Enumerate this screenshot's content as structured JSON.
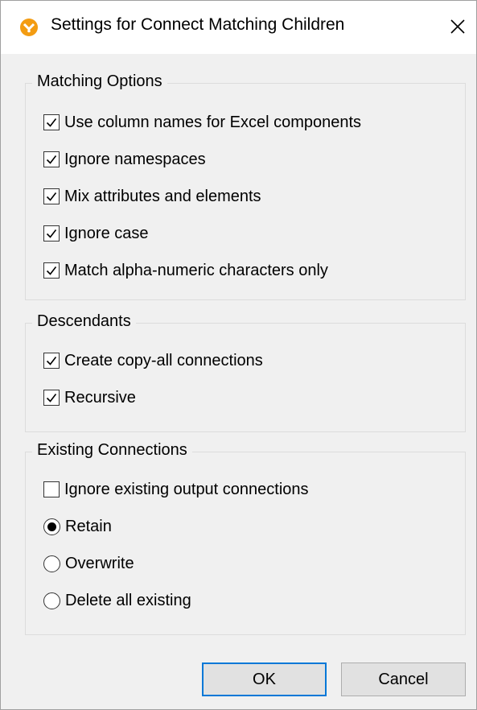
{
  "window": {
    "title": "Settings for Connect Matching Children",
    "close_label": "✕"
  },
  "matching_options": {
    "legend": "Matching Options",
    "items": [
      {
        "label": "Use column names for Excel components",
        "checked": true
      },
      {
        "label": "Ignore namespaces",
        "checked": true
      },
      {
        "label": "Mix attributes and elements",
        "checked": true
      },
      {
        "label": "Ignore case",
        "checked": true
      },
      {
        "label": "Match alpha-numeric characters only",
        "checked": true
      }
    ]
  },
  "descendants": {
    "legend": "Descendants",
    "items": [
      {
        "label": "Create copy-all connections",
        "checked": true
      },
      {
        "label": "Recursive",
        "checked": true
      }
    ]
  },
  "existing_connections": {
    "legend": "Existing Connections",
    "ignore_output": {
      "label": "Ignore existing output connections",
      "checked": false
    },
    "radios": [
      {
        "label": "Retain",
        "selected": true
      },
      {
        "label": "Overwrite",
        "selected": false
      },
      {
        "label": "Delete all existing",
        "selected": false
      }
    ]
  },
  "buttons": {
    "ok": "OK",
    "cancel": "Cancel"
  },
  "colors": {
    "app_icon": "#f39c12",
    "default_button_border": "#0078d7",
    "dialog_background": "#f0f0f0"
  }
}
